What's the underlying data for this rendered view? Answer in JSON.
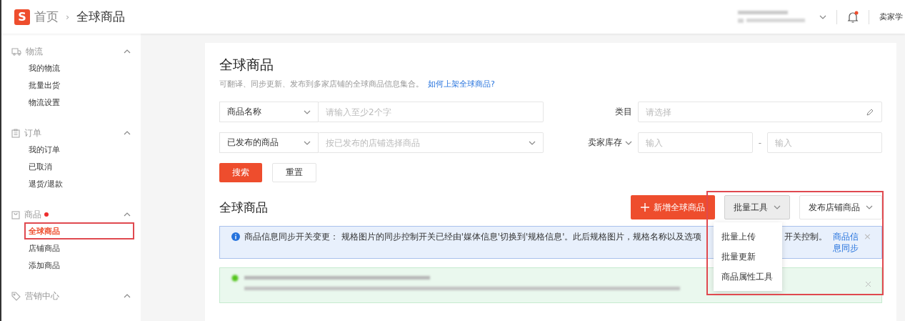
{
  "header": {
    "logo_letter": "S",
    "breadcrumb_separator": "›",
    "breadcrumb": [
      {
        "label": "首页",
        "selected": false
      },
      {
        "label": "全球商品",
        "selected": true
      }
    ],
    "notification_dot": true,
    "right_label": "卖家学"
  },
  "sidebar": {
    "sections": [
      {
        "title": "物流",
        "expanded": true,
        "dot": false,
        "items": [
          {
            "label": "我的物流",
            "selected": false
          },
          {
            "label": "批量出货",
            "selected": false
          },
          {
            "label": "物流设置",
            "selected": false
          }
        ]
      },
      {
        "title": "订单",
        "expanded": true,
        "dot": false,
        "items": [
          {
            "label": "我的订单",
            "selected": false
          },
          {
            "label": "已取消",
            "selected": false
          },
          {
            "label": "退货/退款",
            "selected": false
          }
        ]
      },
      {
        "title": "商品",
        "expanded": true,
        "dot": true,
        "items": [
          {
            "label": "全球商品",
            "selected": true
          },
          {
            "label": "店铺商品",
            "selected": false
          },
          {
            "label": "添加商品",
            "selected": false
          }
        ]
      },
      {
        "title": "营销中心",
        "expanded": true,
        "dot": false
      }
    ]
  },
  "page": {
    "title": "全球商品",
    "subtitle": "可翻译、同步更新、发布到多家店铺的全球商品信息集合。",
    "help_link": "如何上架全球商品?",
    "filters": {
      "name_select": "商品名称",
      "name_placeholder": "请输入至少2个字",
      "category_label": "类目",
      "category_placeholder": "请选择",
      "published_select": "已发布的商品",
      "shop_placeholder": "按已发布的店铺选择商品",
      "stock_label": "卖家库存",
      "stock_min_placeholder": "输入",
      "stock_separator": "-",
      "stock_max_placeholder": "输入"
    },
    "search_button": "搜索",
    "reset_button": "重置"
  },
  "list": {
    "title": "全球商品",
    "add_button": "新增全球商品",
    "bulk_button": "批量工具",
    "publish_button": "发布店铺商品",
    "bulk_menu": {
      "open": true,
      "items": [
        {
          "label": "批量上传"
        },
        {
          "label": "批量更新"
        },
        {
          "label": "商品属性工具"
        }
      ]
    },
    "info_alert": {
      "text": "商品信息同步开关变更： 规格图片的同步控制开关已经由'媒体信息'切换到'规格信息'。此后规格图片，规格名称以及选项",
      "text_after": "开关控制。",
      "link": "商品信息同步",
      "close": "×"
    },
    "success_alert": {
      "kind": "blurred"
    }
  }
}
